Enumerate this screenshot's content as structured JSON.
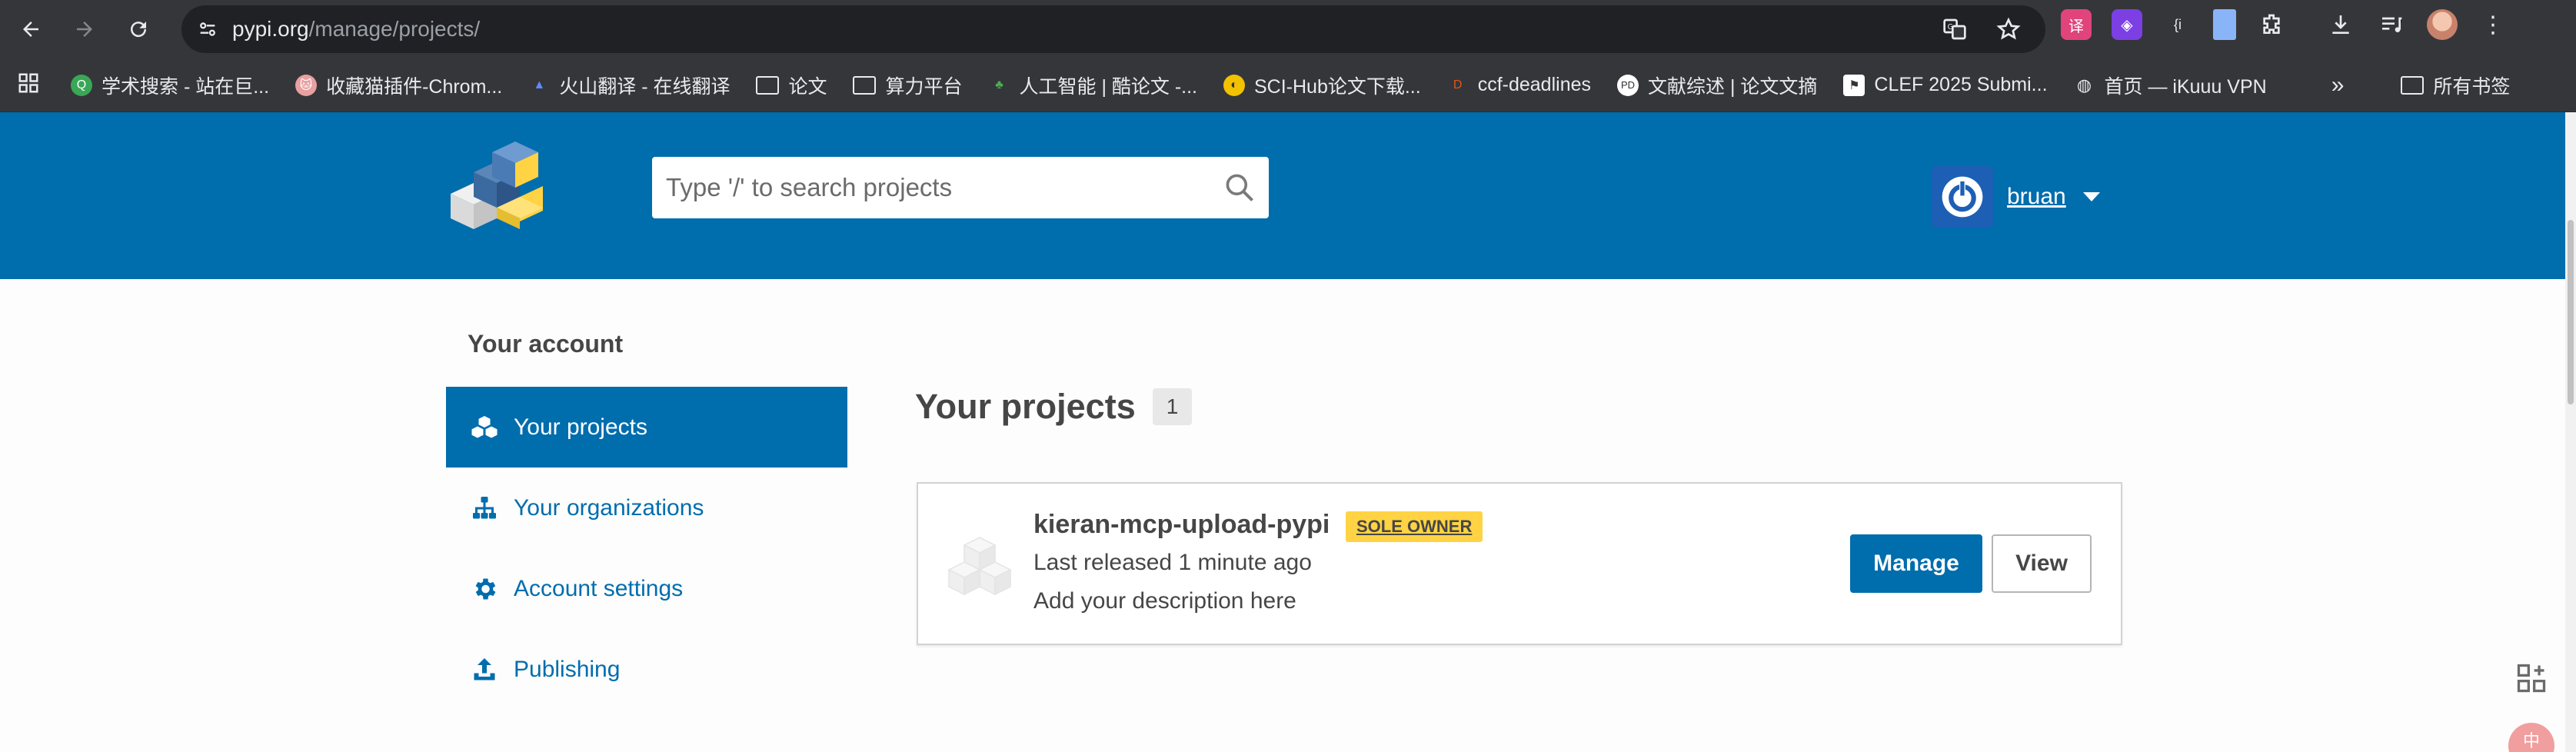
{
  "browser": {
    "url_host": "pypi.org",
    "url_path": "/manage/projects/",
    "bookmarks": [
      {
        "label": "学术搜索 - 站在巨...",
        "icon": "scholar-icon",
        "color": "#3aa757"
      },
      {
        "label": "收藏猫插件-Chrom...",
        "icon": "cat-icon",
        "color": "#e8a0a0"
      },
      {
        "label": "火山翻译 - 在线翻译",
        "icon": "volcano-icon",
        "color": "#3d6fff"
      },
      {
        "label": "论文",
        "icon": "folder-icon",
        "color": "#e8eaed"
      },
      {
        "label": "算力平台",
        "icon": "folder-icon",
        "color": "#e8eaed"
      },
      {
        "label": "人工智能 | 酷论文 -...",
        "icon": "tree-icon",
        "color": "#4caf50"
      },
      {
        "label": "SCI-Hub论文下载...",
        "icon": "scihub-icon",
        "color": "#f2c200"
      },
      {
        "label": "ccf-deadlines",
        "icon": "ccf-icon",
        "color": "#e0561b"
      },
      {
        "label": "文献综述 | 论文文摘",
        "icon": "pd-icon",
        "color": "#ffffff"
      },
      {
        "label": "CLEF 2025 Submi...",
        "icon": "flag-icon",
        "color": "#ffffff"
      },
      {
        "label": "首页 — iKuuu VPN",
        "icon": "globe-icon",
        "color": "#e8eaed"
      }
    ],
    "bookmarks_overflow": "»",
    "all_bookmarks": "所有书签",
    "ext_badge_text": "{i"
  },
  "header": {
    "search_placeholder": "Type '/' to search projects",
    "username": "bruan"
  },
  "sidebar": {
    "title": "Your account",
    "items": [
      {
        "label": "Your projects",
        "icon": "cubes-icon",
        "active": true
      },
      {
        "label": "Your organizations",
        "icon": "sitemap-icon",
        "active": false
      },
      {
        "label": "Account settings",
        "icon": "gear-icon",
        "active": false
      },
      {
        "label": "Publishing",
        "icon": "upload-icon",
        "active": false
      }
    ]
  },
  "main": {
    "title": "Your projects",
    "count": "1",
    "projects": [
      {
        "name": "kieran-mcp-upload-pypi",
        "badge": "SOLE OWNER",
        "released": "Last released 1 minute ago",
        "description": "Add your description here",
        "manage_label": "Manage",
        "view_label": "View"
      }
    ]
  },
  "floating": {
    "lang_badge": "中"
  },
  "colors": {
    "pypi_blue": "#006dad",
    "badge_yellow": "#ffd343",
    "chrome_dark": "#35363a"
  }
}
